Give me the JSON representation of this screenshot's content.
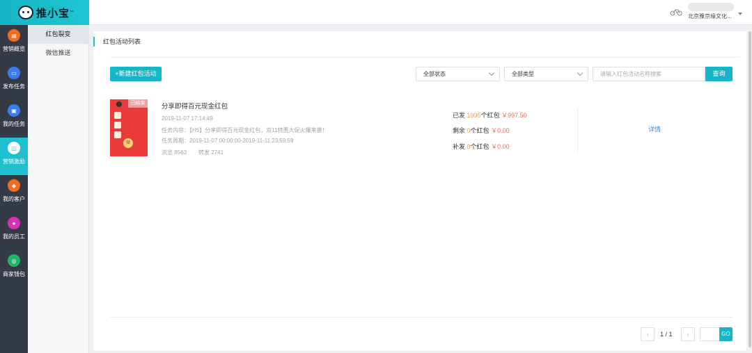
{
  "app": {
    "name": "推小宝",
    "tm": "™"
  },
  "header": {
    "company": "北京豫京缘文化..."
  },
  "leftnav": [
    {
      "label": "营销概览",
      "icon": "chart-icon",
      "color": "#f36c22",
      "glyph": "▤"
    },
    {
      "label": "发布任务",
      "icon": "task-icon",
      "color": "#3a7df0",
      "glyph": "▭"
    },
    {
      "label": "我的任务",
      "icon": "list-icon",
      "color": "#3a7df0",
      "glyph": "▣"
    },
    {
      "label": "营销激励",
      "icon": "gift-icon",
      "color": "#ffffff",
      "glyph": "◫",
      "active": true
    },
    {
      "label": "我的客户",
      "icon": "customer-icon",
      "color": "#f36c22",
      "glyph": "◆"
    },
    {
      "label": "我的员工",
      "icon": "employee-icon",
      "color": "#d830b8",
      "glyph": "●"
    },
    {
      "label": "商家钱包",
      "icon": "wallet-icon",
      "color": "#21b56a",
      "glyph": "◎"
    }
  ],
  "subnav": [
    {
      "label": "红包裂变",
      "active": true
    },
    {
      "label": "微信推送",
      "active": false
    }
  ],
  "main": {
    "breadcrumb": "红包活动列表",
    "create_button": "+新建红包活动",
    "status_select": "全部状态",
    "type_select": "全部类型",
    "search_placeholder": "请输入红包活动名称搜索",
    "query_button": "查询"
  },
  "activity": {
    "thumb_badge": "已结束",
    "thumb_coin": "微",
    "title": "分享即得百元现金红包",
    "created": "2019-11-07 17:14:49",
    "content": "任务内容：【H5】分享即得百元现金红包，双11特惠大促火爆来袭！",
    "period": "任务周期：2019-11-07 00:00:00-2019-11-11 23:59:59",
    "views": "浏览 8563",
    "shares": "转发 2741",
    "sent": {
      "label": "已发",
      "count": "1995",
      "unit": "个红包",
      "amount": "￥997.50"
    },
    "remaining": {
      "label": "剩余",
      "count": "0",
      "unit": "个红包",
      "amount": "￥0.00"
    },
    "reissue": {
      "label": "补发",
      "count": "0",
      "unit": "个红包",
      "amount": "￥0.00"
    },
    "detail_link": "详情"
  },
  "pagination": {
    "prev": "‹",
    "next": "›",
    "info": "1 / 1",
    "go": "GO"
  }
}
